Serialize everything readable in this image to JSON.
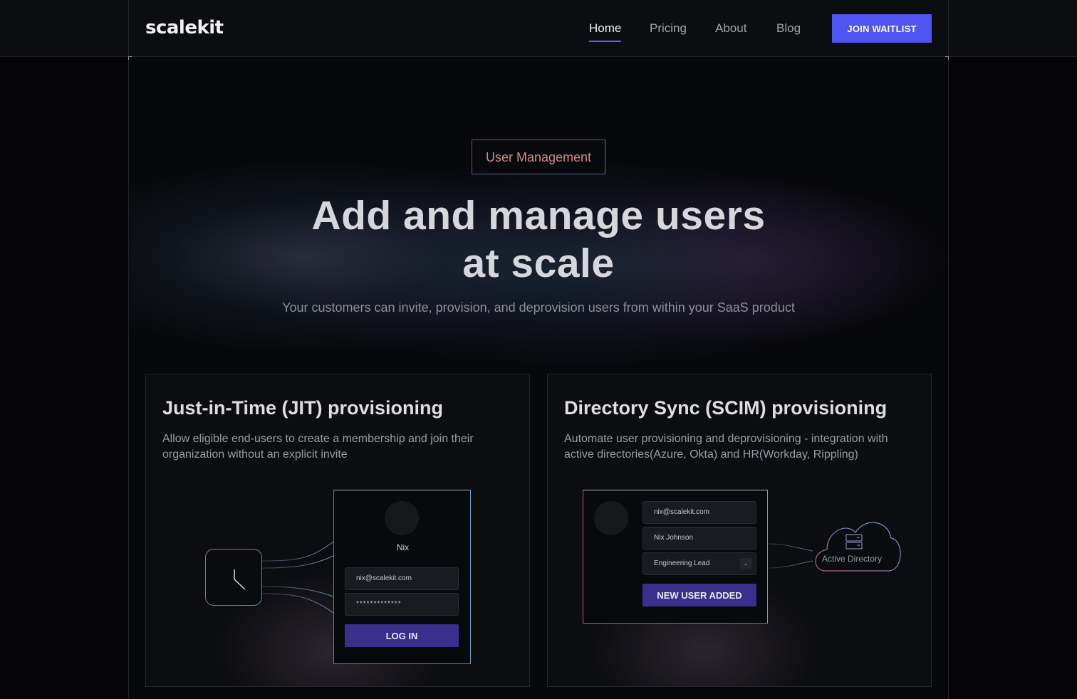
{
  "nav": {
    "logo": "scalekit",
    "links": [
      "Home",
      "Pricing",
      "About",
      "Blog"
    ],
    "active": "Home",
    "cta": "JOIN WAITLIST"
  },
  "hero": {
    "badge": "User Management",
    "title_line1": "Add and manage users",
    "title_line2": "at scale",
    "subtitle": "Your customers can invite, provision, and deprovision users from within your SaaS product"
  },
  "cards": {
    "jit": {
      "title": "Just-in-Time (JIT) provisioning",
      "desc_line1": "Allow eligible end-users to create a membership and join their",
      "desc_line2": "organization without an explicit invite",
      "user_name": "Nix",
      "email": "nix@scalekit.com",
      "password_mask": "*************",
      "button": "LOG IN"
    },
    "scim": {
      "title": "Directory Sync (SCIM) provisioning",
      "desc_line1": "Automate user provisioning and deprovisioning - integration with",
      "desc_line2": "active directories(Azure, Okta) and HR(Workday, Rippling)",
      "email": "nix@scalekit.com",
      "full_name": "Nix Johnson",
      "role": "Engineering Lead",
      "button": "NEW USER ADDED",
      "directory_label": "Active Directory"
    }
  },
  "colors": {
    "accent": "#4f55f0",
    "button_purple": "#3a2f8c",
    "background": "#07080b"
  }
}
